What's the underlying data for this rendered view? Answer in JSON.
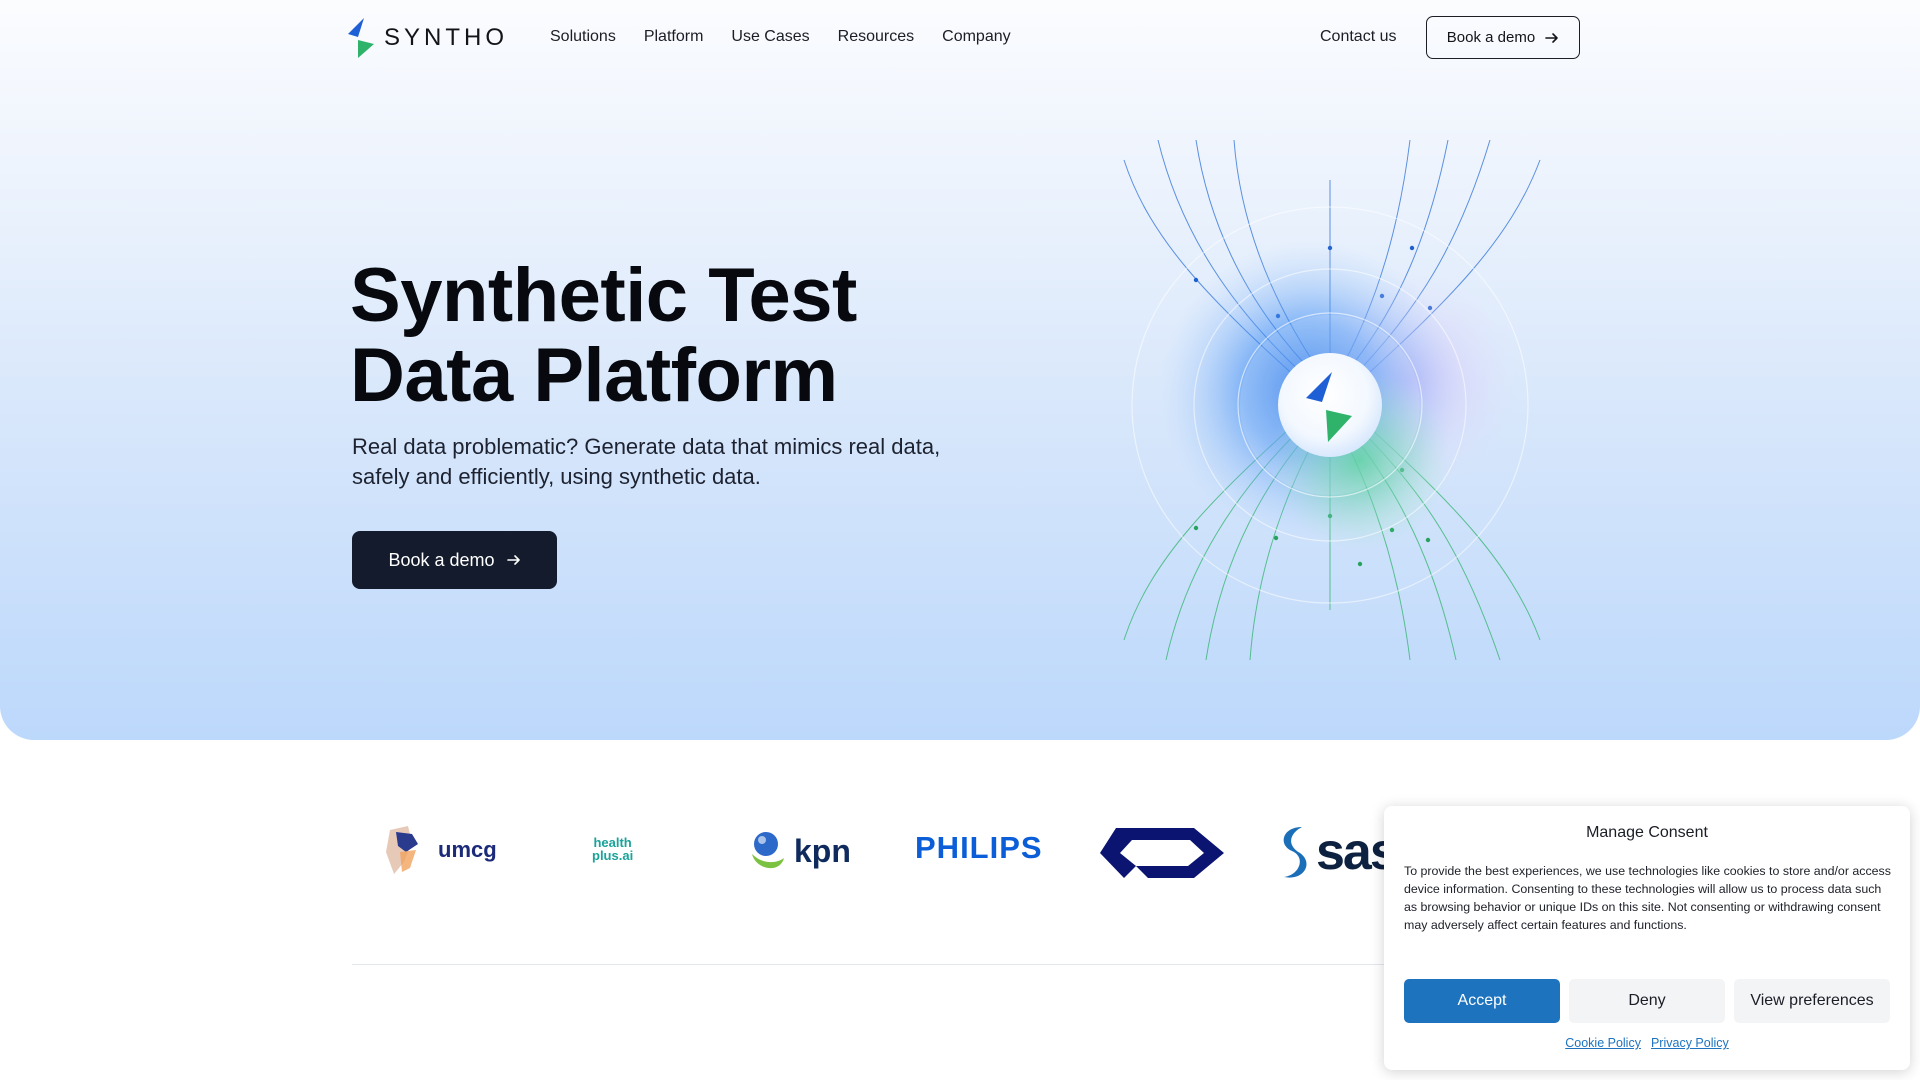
{
  "nav": {
    "logo_text": "SYNTHO",
    "links": [
      "Solutions",
      "Platform",
      "Use Cases",
      "Resources",
      "Company"
    ],
    "contact": "Contact us",
    "demo_label": "Book a demo"
  },
  "hero": {
    "title_line1": "Synthetic Test",
    "title_line2": "Data Platform",
    "subtitle_line1": "Real data problematic? Generate data that mimics real data,",
    "subtitle_line2": "safely and efficiently, using synthetic data.",
    "cta_label": "Book a demo"
  },
  "logos": {
    "umcg": "umcg",
    "healthplus_line1": "health",
    "healthplus_line2": "plus.ai",
    "kpn": "kpn",
    "philips": "PHILIPS",
    "sas": "sas"
  },
  "consent": {
    "title": "Manage Consent",
    "body": "To provide the best experiences, we use technologies like cookies to store and/or access device information. Consenting to these technologies will allow us to process data such as browsing behavior or unique IDs on this site. Not consenting or withdrawing consent may adversely affect certain features and functions.",
    "accept": "Accept",
    "deny": "Deny",
    "preferences": "View preferences",
    "cookie_policy": "Cookie Policy",
    "privacy_policy": "Privacy Policy"
  },
  "colors": {
    "brand_blue": "#1e73be",
    "brand_green": "#2fb36b",
    "dark_button": "#141b2c",
    "philips_blue": "#0b5ed7",
    "ns_navy": "#0b1470"
  },
  "icons": [
    "syntho-logo-icon",
    "arrow-right-icon",
    "orb-logo-icon"
  ]
}
